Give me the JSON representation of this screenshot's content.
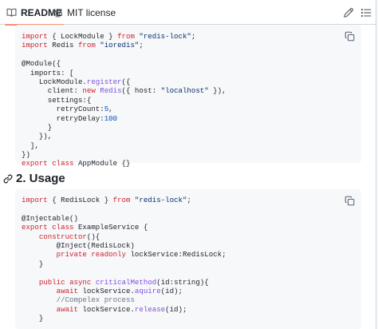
{
  "tabs": {
    "readme": "README",
    "license": "MIT license"
  },
  "icons": {
    "readme": "book-icon",
    "license": "scale-balance-icon",
    "edit": "pencil-icon",
    "toc": "list-icon",
    "copy": "copy-icon",
    "anchor": "link-icon"
  },
  "colors": {
    "active_tab_underline": "#fd8c73",
    "keyword": "#cf222e",
    "string": "#0a3069",
    "function": "#8250df",
    "number": "#0550ae",
    "comment": "#6e7781",
    "code_background": "#f6f8fa"
  },
  "code_block_1": {
    "lines": [
      [
        {
          "t": "k",
          "v": "import"
        },
        {
          "t": "p",
          "v": " { LockModule } "
        },
        {
          "t": "k",
          "v": "from"
        },
        {
          "t": "p",
          "v": " "
        },
        {
          "t": "s",
          "v": "\"redis-lock\""
        },
        {
          "t": "p",
          "v": ";"
        }
      ],
      [
        {
          "t": "k",
          "v": "import"
        },
        {
          "t": "p",
          "v": " Redis "
        },
        {
          "t": "k",
          "v": "from"
        },
        {
          "t": "p",
          "v": " "
        },
        {
          "t": "s",
          "v": "\"ioredis\""
        },
        {
          "t": "p",
          "v": ";"
        }
      ],
      [],
      [
        {
          "t": "p",
          "v": "@Module({"
        }
      ],
      [
        {
          "t": "p",
          "v": "  imports: ["
        }
      ],
      [
        {
          "t": "p",
          "v": "    LockModule."
        },
        {
          "t": "f",
          "v": "register"
        },
        {
          "t": "p",
          "v": "({"
        }
      ],
      [
        {
          "t": "p",
          "v": "      client: "
        },
        {
          "t": "k",
          "v": "new"
        },
        {
          "t": "p",
          "v": " "
        },
        {
          "t": "f",
          "v": "Redis"
        },
        {
          "t": "p",
          "v": "({ host: "
        },
        {
          "t": "s",
          "v": "\"localhost\""
        },
        {
          "t": "p",
          "v": " }),"
        }
      ],
      [
        {
          "t": "p",
          "v": "      settings:{"
        }
      ],
      [
        {
          "t": "p",
          "v": "        retryCount:"
        },
        {
          "t": "n",
          "v": "5"
        },
        {
          "t": "p",
          "v": ","
        }
      ],
      [
        {
          "t": "p",
          "v": "        retryDelay:"
        },
        {
          "t": "n",
          "v": "100"
        }
      ],
      [
        {
          "t": "p",
          "v": "      }"
        }
      ],
      [
        {
          "t": "p",
          "v": "    }),"
        }
      ],
      [
        {
          "t": "p",
          "v": "  ],"
        }
      ],
      [
        {
          "t": "p",
          "v": "})"
        }
      ],
      [
        {
          "t": "k",
          "v": "export"
        },
        {
          "t": "p",
          "v": " "
        },
        {
          "t": "k",
          "v": "class"
        },
        {
          "t": "p",
          "v": " AppModule {}"
        }
      ]
    ]
  },
  "section_heading": "2. Usage",
  "code_block_2": {
    "lines": [
      [
        {
          "t": "k",
          "v": "import"
        },
        {
          "t": "p",
          "v": " { RedisLock } "
        },
        {
          "t": "k",
          "v": "from"
        },
        {
          "t": "p",
          "v": " "
        },
        {
          "t": "s",
          "v": "\"redis-lock\""
        },
        {
          "t": "p",
          "v": ";"
        }
      ],
      [],
      [
        {
          "t": "p",
          "v": "@Injectable()"
        }
      ],
      [
        {
          "t": "k",
          "v": "export"
        },
        {
          "t": "p",
          "v": " "
        },
        {
          "t": "k",
          "v": "class"
        },
        {
          "t": "p",
          "v": " ExampleService {"
        }
      ],
      [
        {
          "t": "p",
          "v": "    "
        },
        {
          "t": "k",
          "v": "constructor"
        },
        {
          "t": "p",
          "v": "(){"
        }
      ],
      [
        {
          "t": "p",
          "v": "        @Inject(RedisLock)"
        }
      ],
      [
        {
          "t": "p",
          "v": "        "
        },
        {
          "t": "k",
          "v": "private"
        },
        {
          "t": "p",
          "v": " "
        },
        {
          "t": "k",
          "v": "readonly"
        },
        {
          "t": "p",
          "v": " lockService:RedisLock;"
        }
      ],
      [
        {
          "t": "p",
          "v": "    }"
        }
      ],
      [],
      [
        {
          "t": "p",
          "v": "    "
        },
        {
          "t": "k",
          "v": "public"
        },
        {
          "t": "p",
          "v": " "
        },
        {
          "t": "k",
          "v": "async"
        },
        {
          "t": "p",
          "v": " "
        },
        {
          "t": "f",
          "v": "criticalMethod"
        },
        {
          "t": "p",
          "v": "(id:string){"
        }
      ],
      [
        {
          "t": "p",
          "v": "        "
        },
        {
          "t": "k",
          "v": "await"
        },
        {
          "t": "p",
          "v": " lockService."
        },
        {
          "t": "f",
          "v": "aquire"
        },
        {
          "t": "p",
          "v": "(id);"
        }
      ],
      [
        {
          "t": "p",
          "v": "        "
        },
        {
          "t": "c",
          "v": "//Compelex process"
        }
      ],
      [
        {
          "t": "p",
          "v": "        "
        },
        {
          "t": "k",
          "v": "await"
        },
        {
          "t": "p",
          "v": " lockService."
        },
        {
          "t": "f",
          "v": "release"
        },
        {
          "t": "p",
          "v": "(id);"
        }
      ],
      [
        {
          "t": "p",
          "v": "    }"
        }
      ],
      [],
      [
        {
          "t": "p",
          "v": "}"
        }
      ]
    ]
  }
}
